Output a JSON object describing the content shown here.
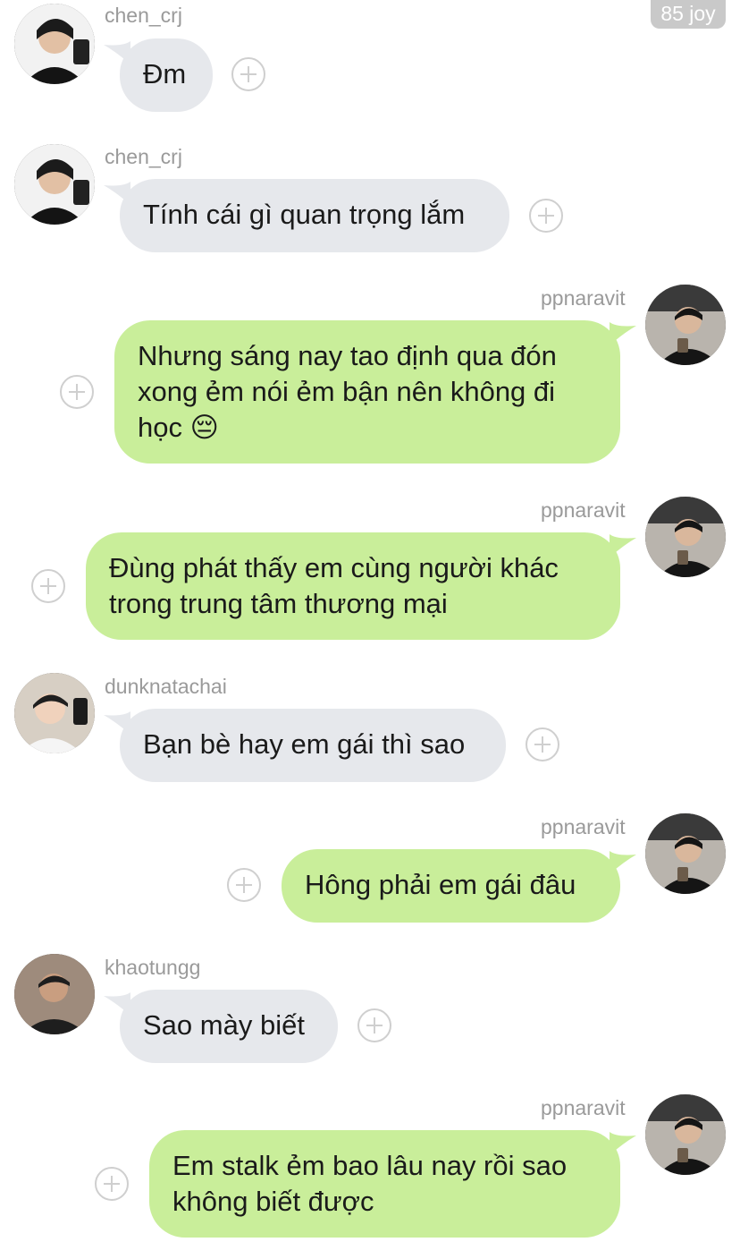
{
  "badge": "85 joy",
  "messages": [
    {
      "user": "chen_crj",
      "side": "in",
      "lines": [
        "Đm"
      ],
      "avatar": "chen"
    },
    {
      "user": "chen_crj",
      "side": "in",
      "lines": [
        "Tính cái gì quan trọng lắm"
      ],
      "avatar": "chen"
    },
    {
      "user": "ppnaravit",
      "side": "out",
      "lines": [
        "Nhưng sáng nay tao định qua đón",
        "xong ẻm nói ẻm bận nên không đi",
        "học 😔"
      ],
      "avatar": "pp"
    },
    {
      "user": "ppnaravit",
      "side": "out",
      "lines": [
        "Đùng phát thấy em cùng người khác",
        "trong trung tâm thương mại"
      ],
      "avatar": "pp"
    },
    {
      "user": "dunknatachai",
      "side": "in",
      "lines": [
        "Bạn bè hay em gái thì sao"
      ],
      "avatar": "dunk"
    },
    {
      "user": "ppnaravit",
      "side": "out",
      "lines": [
        "Hông phải em gái đâu"
      ],
      "avatar": "pp"
    },
    {
      "user": "khaotungg",
      "side": "in",
      "lines": [
        "Sao mày biết"
      ],
      "avatar": "khao"
    },
    {
      "user": "ppnaravit",
      "side": "out",
      "lines": [
        "Em stalk ẻm bao lâu nay rồi sao",
        "không biết được"
      ],
      "avatar": "pp"
    }
  ],
  "icons": {
    "add": "plus-circle-icon"
  },
  "colors": {
    "incoming": "#e6e8ec",
    "outgoing": "#c9ee9a",
    "username": "#9a9a9a",
    "badge": "#c9c9c9"
  }
}
